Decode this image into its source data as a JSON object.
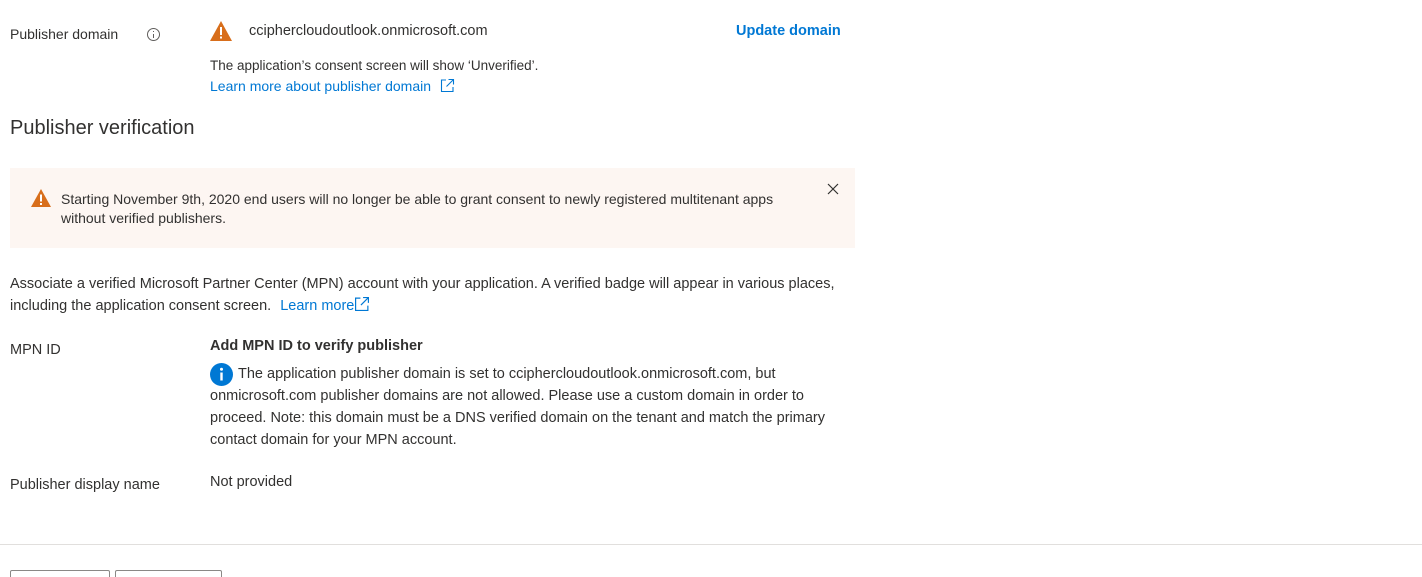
{
  "publisher_domain": {
    "label": "Publisher domain",
    "domain_value": "cciphercloudoutlook.onmicrosoft.com",
    "update_link": "Update domain",
    "consent_note": "The application’s consent screen will show ‘Unverified’.",
    "learn_more": "Learn more about publisher domain"
  },
  "publisher_verification": {
    "title": "Publisher verification",
    "banner_text": "Starting November 9th, 2020 end users will no longer be able to grant consent to newly registered multitenant apps without verified publishers.",
    "description": "Associate a verified Microsoft Partner Center (MPN) account with your application. A verified badge will appear in various places, including the application consent screen.",
    "learn_more": "Learn more",
    "mpn_label": "MPN ID",
    "mpn_heading": "Add MPN ID to verify publisher",
    "mpn_info": "The application publisher domain is set to cciphercloudoutlook.onmicrosoft.com, but onmicrosoft.com publisher domains are not allowed. Please use a custom domain in order to proceed. Note: this domain must be a DNS verified domain on the tenant and match the primary contact domain for your MPN account.",
    "display_name_label": "Publisher display name",
    "display_name_value": "Not provided"
  },
  "colors": {
    "accent": "#0078d4",
    "warning": "#d83b01",
    "banner_bg": "#fdf6f2"
  }
}
